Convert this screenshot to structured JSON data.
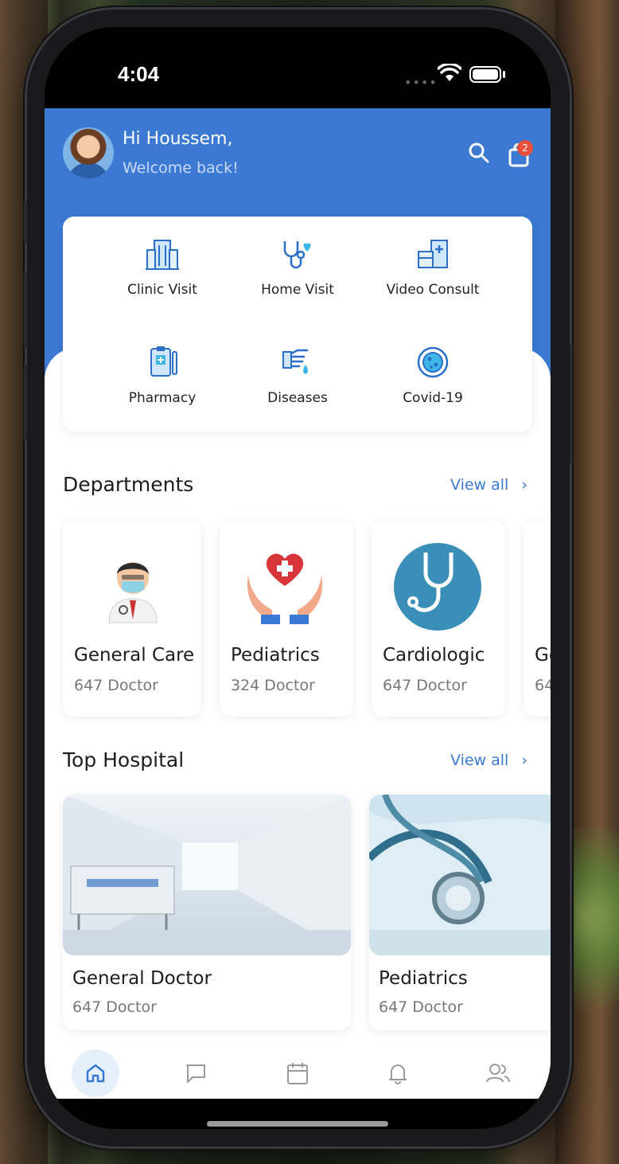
{
  "status": {
    "time": "4:04"
  },
  "header": {
    "greeting": "Hi Houssem,",
    "subtitle": "Welcome back!",
    "cart_badge": "2"
  },
  "quick_actions": [
    {
      "label": "Clinic Visit",
      "icon": "hospital-building-icon"
    },
    {
      "label": "Home Visit",
      "icon": "stethoscope-heart-icon"
    },
    {
      "label": "Video Consult",
      "icon": "medical-monitor-icon"
    },
    {
      "label": "Pharmacy",
      "icon": "clipboard-pill-icon"
    },
    {
      "label": "Diseases",
      "icon": "hand-drop-icon"
    },
    {
      "label": "Covid-19",
      "icon": "virus-icon"
    }
  ],
  "departments": {
    "title": "Departments",
    "view_all": "View all",
    "items": [
      {
        "name": "General Care",
        "count": "647 Doctor"
      },
      {
        "name": "Pediatrics",
        "count": "324 Doctor"
      },
      {
        "name": "Cardiologic",
        "count": "647 Doctor"
      },
      {
        "name": "Ge",
        "count": "64"
      }
    ]
  },
  "hospitals": {
    "title": "Top Hospital",
    "view_all": "View all",
    "items": [
      {
        "name": "General Doctor",
        "count": "647 Doctor"
      },
      {
        "name": "Pediatrics",
        "count": "647 Doctor"
      }
    ]
  },
  "tabbar": [
    "home-icon",
    "chat-icon",
    "calendar-icon",
    "bell-icon",
    "users-icon"
  ],
  "colors": {
    "primary": "#3b79d3",
    "badge": "#e8503a"
  }
}
